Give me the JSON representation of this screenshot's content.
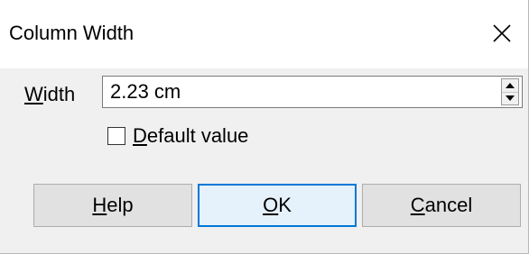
{
  "dialog": {
    "title": "Column Width",
    "close_glyph": "✕"
  },
  "width": {
    "label_accel": "W",
    "label_rest": "idth",
    "value": "2.23 cm"
  },
  "default_value": {
    "label_accel": "D",
    "label_rest": "efault value",
    "checked": false
  },
  "buttons": {
    "help_accel": "H",
    "help_rest": "elp",
    "ok_accel": "O",
    "ok_rest": "K",
    "cancel_accel": "C",
    "cancel_rest": "ancel"
  },
  "icons": {
    "close": "close-icon",
    "spin_up": "spin-up-icon",
    "spin_down": "spin-down-icon"
  },
  "colors": {
    "default_button_border": "#0078d7",
    "default_button_background": "#e5f1fb",
    "dialog_background": "#f0f0f0"
  }
}
